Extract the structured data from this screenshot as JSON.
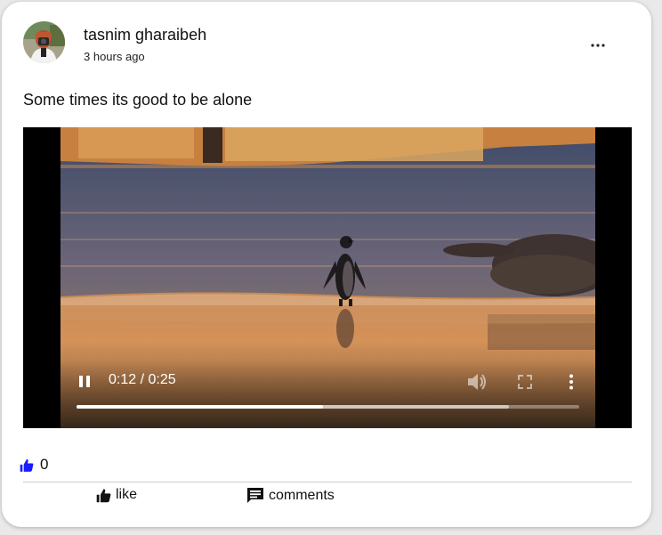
{
  "post": {
    "author": "tasnim gharaibeh",
    "timestamp": "3 hours ago",
    "text": "Some times its good to be alone",
    "menu_icon": "more-horizontal-icon"
  },
  "video": {
    "time": "0:12 / 0:25",
    "progress": 0.49,
    "buffered": 0.86,
    "state": "playing",
    "icons": [
      "pause-icon",
      "volume-icon",
      "fullscreen-icon",
      "more-vertical-icon"
    ]
  },
  "reactions": {
    "like_count": "0",
    "like_color": "#1a1aff"
  },
  "actions": {
    "like_label": "like",
    "comments_label": "comments"
  }
}
